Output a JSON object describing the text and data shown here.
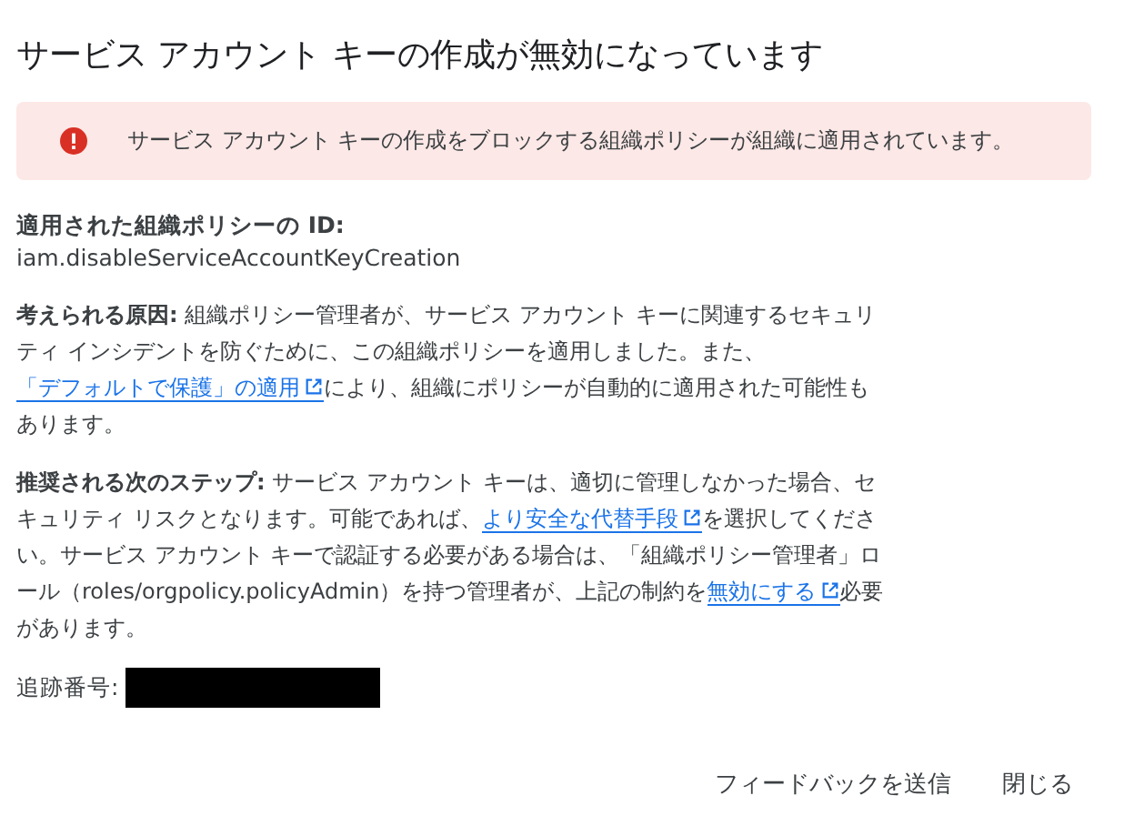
{
  "dialog": {
    "title": "サービス アカウント キーの作成が無効になっています",
    "alert": {
      "kind": "error",
      "message": "サービス アカウント キーの作成をブロックする組織ポリシーが組織に適用されています。"
    },
    "policy": {
      "label": "適用された組織ポリシーの ID:",
      "value": "iam.disableServiceAccountKeyCreation"
    },
    "paragraphs": [
      [
        {
          "kind": "label",
          "text": "考えられる原因:"
        },
        {
          "kind": "text",
          "text": " 組織ポリシー管理者が、サービス アカウント キーに関連するセキュリティ インシデントを防ぐために、この組織ポリシーを適用しました。また、"
        },
        {
          "kind": "link",
          "text": "「デフォルトで保護」の適用"
        },
        {
          "kind": "text",
          "text": "により、組織にポリシーが自動的に適用された可能性もあります。"
        }
      ],
      [
        {
          "kind": "label",
          "text": "推奨される次のステップ:"
        },
        {
          "kind": "text",
          "text": " サービス アカウント キーは、適切に管理しなかった場合、セキュリティ リスクとなります。可能であれば、"
        },
        {
          "kind": "link",
          "text": "より安全な代替手段"
        },
        {
          "kind": "text",
          "text": "を選択してください。サービス アカウント キーで認証する必要がある場合は、「組織ポリシー管理者」ロール（roles/orgpolicy.policyAdmin）を持つ管理者が、上記の制約を"
        },
        {
          "kind": "link",
          "text": "無効にする"
        },
        {
          "kind": "text",
          "text": "必要があります。"
        }
      ]
    ],
    "tracking": {
      "label": "追跡番号:",
      "redacted": true
    },
    "buttons": [
      "フィードバックを送信",
      "閉じる"
    ]
  }
}
